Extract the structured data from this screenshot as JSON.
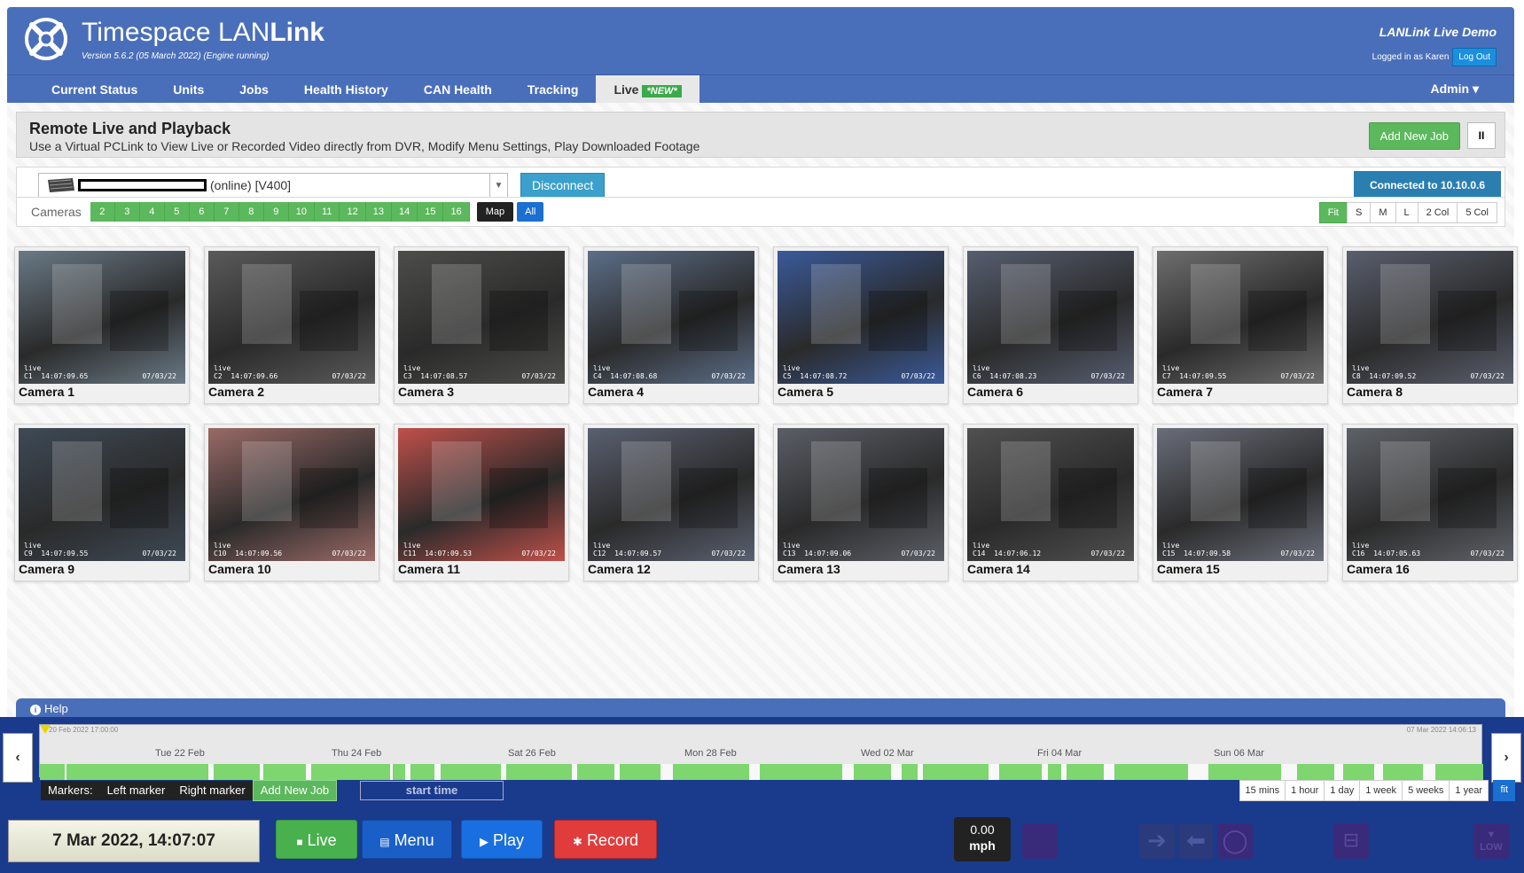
{
  "app": {
    "brand_prefix": "Timespace LAN",
    "brand_bold": "Link",
    "version": "Version 5.6.2 (05 March 2022) (Engine running)",
    "demo_title": "LANLink Live Demo",
    "logged_in": "Logged in as Karen",
    "logout_label": "Log Out"
  },
  "nav": {
    "items": [
      "Current Status",
      "Units",
      "Jobs",
      "Health History",
      "CAN Health",
      "Tracking"
    ],
    "active_label": "Live",
    "active_badge": "*NEW*",
    "admin_label": "Admin"
  },
  "page": {
    "title": "Remote Live and Playback",
    "subtitle": "Use a Virtual PCLink to View Live or Recorded Video directly from DVR, Modify Menu Settings, Play Downloaded Footage",
    "add_job_label": "Add New Job",
    "pause_label": "II"
  },
  "device": {
    "status_text": "(online) [V400]",
    "disconnect_label": "Disconnect",
    "connected_label": "Connected to 10.10.0.6"
  },
  "camera_bar": {
    "label": "Cameras",
    "buttons": [
      "2",
      "3",
      "4",
      "5",
      "6",
      "7",
      "8",
      "9",
      "10",
      "11",
      "12",
      "13",
      "14",
      "15",
      "16"
    ],
    "map_label": "Map",
    "all_label": "All",
    "sizes": [
      "Fit",
      "S",
      "M",
      "L",
      "2 Col",
      "5 Col"
    ],
    "active_size": "Fit"
  },
  "cameras": [
    {
      "name": "Camera 1",
      "id": "C1",
      "time": "14:07:09.65",
      "date": "07/03/22"
    },
    {
      "name": "Camera 2",
      "id": "C2",
      "time": "14:07:09.66",
      "date": "07/03/22"
    },
    {
      "name": "Camera 3",
      "id": "C3",
      "time": "14:07:08.57",
      "date": "07/03/22"
    },
    {
      "name": "Camera 4",
      "id": "C4",
      "time": "14:07:08.68",
      "date": "07/03/22"
    },
    {
      "name": "Camera 5",
      "id": "C5",
      "time": "14:07:08.72",
      "date": "07/03/22"
    },
    {
      "name": "Camera 6",
      "id": "C6",
      "time": "14:07:08.23",
      "date": "07/03/22"
    },
    {
      "name": "Camera 7",
      "id": "C7",
      "time": "14:07:09.55",
      "date": "07/03/22"
    },
    {
      "name": "Camera 8",
      "id": "C8",
      "time": "14:07:09.52",
      "date": "07/03/22"
    },
    {
      "name": "Camera 9",
      "id": "C9",
      "time": "14:07:09.55",
      "date": "07/03/22"
    },
    {
      "name": "Camera 10",
      "id": "C10",
      "time": "14:07:09.56",
      "date": "07/03/22"
    },
    {
      "name": "Camera 11",
      "id": "C11",
      "time": "14:07:09.53",
      "date": "07/03/22"
    },
    {
      "name": "Camera 12",
      "id": "C12",
      "time": "14:07:09.57",
      "date": "07/03/22"
    },
    {
      "name": "Camera 13",
      "id": "C13",
      "time": "14:07:09.06",
      "date": "07/03/22"
    },
    {
      "name": "Camera 14",
      "id": "C14",
      "time": "14:07:06.12",
      "date": "07/03/22"
    },
    {
      "name": "Camera 15",
      "id": "C15",
      "time": "14:07:09.58",
      "date": "07/03/22"
    },
    {
      "name": "Camera 16",
      "id": "C16",
      "time": "14:07:05.63",
      "date": "07/03/22"
    }
  ],
  "camera_scene_colors": [
    "#6a7a86",
    "#5a5a5a",
    "#4d4d4a",
    "#5c6e88",
    "#3a5a9a",
    "#565e70",
    "#6e6e6e",
    "#5a5f6e",
    "#3e4a56",
    "#9a6a66",
    "#c0504a",
    "#5a6070",
    "#5a5e66",
    "#505050",
    "#6a6e7a",
    "#5e6268"
  ],
  "osd_live": "live",
  "help": {
    "label": "Help"
  },
  "timeline": {
    "start_label": "20 Feb 2022 17:00:00",
    "end_label": "07 Mar 2022 14:06:13",
    "day_labels": [
      "Tue 22 Feb",
      "Thu 24 Feb",
      "Sat 26 Feb",
      "Mon 28 Feb",
      "Wed 02 Mar",
      "Fri 04 Mar",
      "Sun 06 Mar"
    ],
    "markers_label": "Markers:",
    "left_marker": "Left marker",
    "right_marker": "Right marker",
    "add_job": "Add New Job",
    "start_time": "start time",
    "ranges": [
      "15 mins",
      "1 hour",
      "1 day",
      "1 week",
      "5 weeks",
      "1 year"
    ],
    "fit_label": "fit",
    "accent": "#7dd66e"
  },
  "controls": {
    "clock": "7 Mar 2022, 14:07:07",
    "live_label": "Live",
    "menu_label": "Menu",
    "play_label": "Play",
    "record_label": "Record",
    "speed_value": "0.00",
    "speed_unit": "mph",
    "low_label": "LOW"
  }
}
